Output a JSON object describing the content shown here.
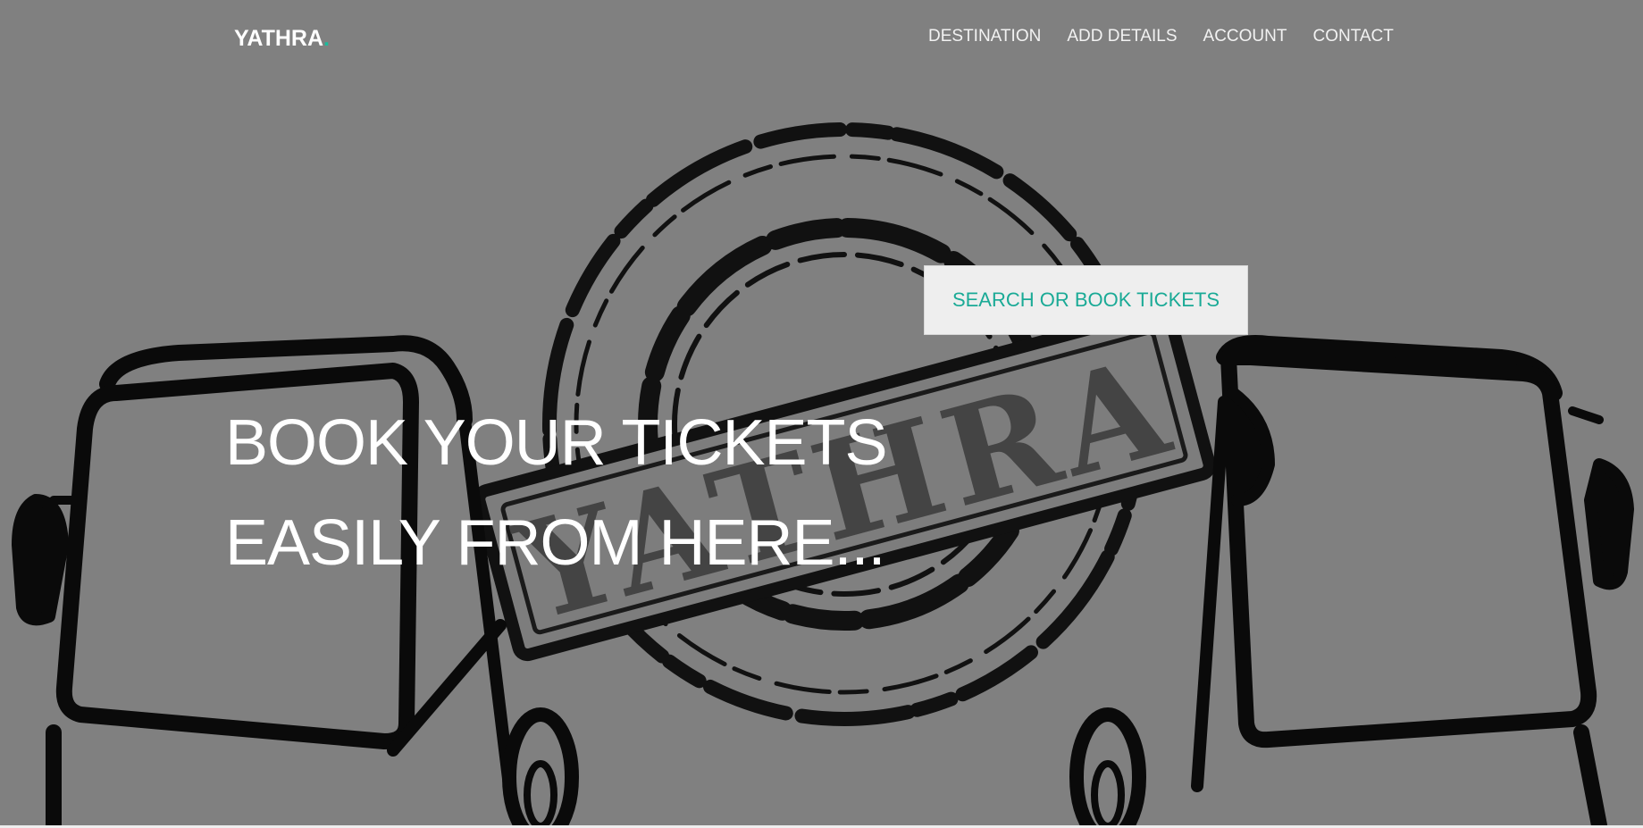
{
  "brand": {
    "name": "YATHRA",
    "dot": ".",
    "dot_color": "#1abc9c"
  },
  "nav": {
    "items": [
      {
        "label": "DESTINATION"
      },
      {
        "label": "ADD DETAILS"
      },
      {
        "label": "ACCOUNT"
      },
      {
        "label": "CONTACT"
      }
    ]
  },
  "hero": {
    "cta_label": "SEARCH OR BOOK TICKETS",
    "headline_line1": "BOOK YOUR TICKETS",
    "headline_line2": "EASILY FROM HERE...",
    "background_image": "yathra-stamp-buses-illustration",
    "stamp_text": "YATHRA",
    "accent_color": "#1aaa96",
    "background_color": "#808080"
  }
}
